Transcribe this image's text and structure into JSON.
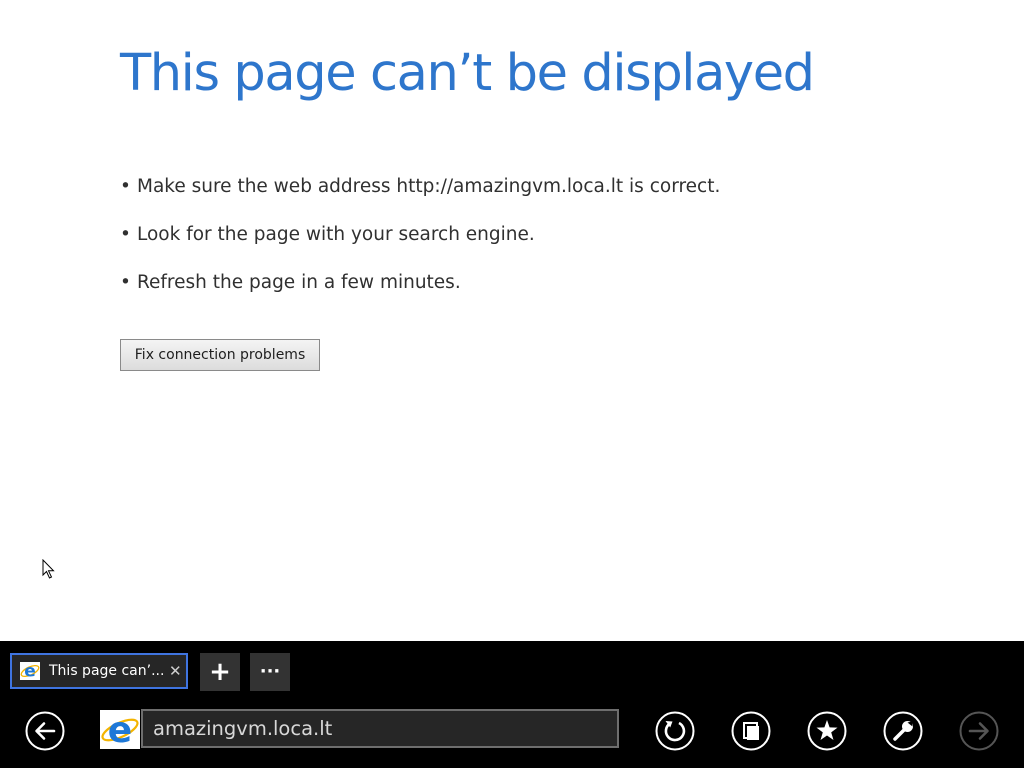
{
  "page": {
    "title": "This page can’t be displayed",
    "tips": [
      "Make sure the web address http://amazingvm.loca.lt is correct.",
      "Look for the page with your search engine.",
      "Refresh the page in a few minutes."
    ],
    "bullet": "•",
    "fix_button": "Fix connection problems"
  },
  "tabs": {
    "active_title": "This page can’...",
    "close_glyph": "✕",
    "new_tab_glyph": "+",
    "more_glyph": "···"
  },
  "address_bar": {
    "url": "amazingvm.loca.lt"
  },
  "colors": {
    "title": "#2e76cc",
    "appbar_background": "#000000",
    "tab_border": "#3f74e0"
  },
  "icons": [
    "ie-logo-icon",
    "cursor-icon",
    "back-icon",
    "refresh-icon",
    "tab-switch-icon",
    "favorites-icon",
    "tools-icon",
    "forward-icon"
  ]
}
